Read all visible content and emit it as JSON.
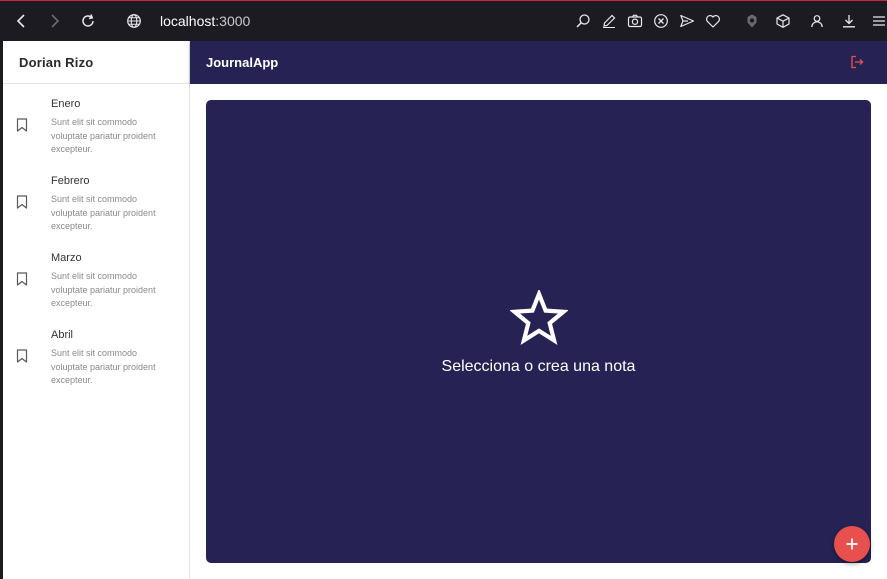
{
  "browser": {
    "url_host": "localhost",
    "url_port": ":3000",
    "icons": [
      "back-icon",
      "forward-icon",
      "reload-icon",
      "globe-icon",
      "search-page-icon",
      "edit-icon",
      "camera-icon",
      "block-icon",
      "send-icon",
      "heart-icon",
      "extension-icon",
      "box-icon",
      "profile-icon",
      "download-icon",
      "menu-icon"
    ]
  },
  "sidebar": {
    "user_name": "Dorian Rizo",
    "entries": [
      {
        "title": "Enero",
        "body": "Sunt elit sit commodo voluptate pariatur proident excepteur."
      },
      {
        "title": "Febrero",
        "body": "Sunt elit sit commodo voluptate pariatur proident excepteur."
      },
      {
        "title": "Marzo",
        "body": "Sunt elit sit commodo voluptate pariatur proident excepteur."
      },
      {
        "title": "Abril",
        "body": "Sunt elit sit commodo voluptate pariatur proident excepteur."
      }
    ]
  },
  "appbar": {
    "title": "JournalApp"
  },
  "main": {
    "empty_message": "Selecciona o crea una nota"
  },
  "colors": {
    "primary": "#262253",
    "accent": "#e8504e",
    "chrome": "#1c1b22"
  }
}
